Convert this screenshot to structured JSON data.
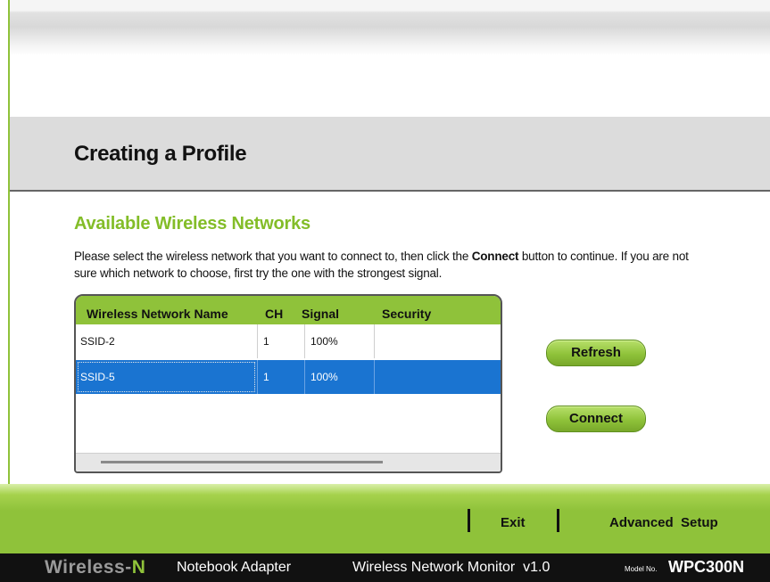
{
  "header": {
    "title": "Creating a Profile"
  },
  "section": {
    "title": "Available Wireless Networks",
    "instructions_before": "Please select the wireless network that you want to connect to, then click the ",
    "instructions_bold": "Connect",
    "instructions_after": " button to continue. If you are not sure which network to choose, first try the one with the strongest signal."
  },
  "table": {
    "columns": [
      "Wireless Network Name",
      "CH",
      "Signal",
      "Security"
    ],
    "rows": [
      {
        "name": "SSID-2",
        "ch": "1",
        "signal": "100%",
        "security": "",
        "selected": false
      },
      {
        "name": "SSID-5",
        "ch": "1",
        "signal": "100%",
        "security": "",
        "selected": true
      }
    ]
  },
  "buttons": {
    "refresh": "Refresh",
    "connect": "Connect"
  },
  "footer": {
    "exit": "Exit",
    "advanced_setup": "Advanced  Setup"
  },
  "bottom_bar": {
    "brand_prefix": "Wireless-",
    "brand_suffix": "N",
    "product": "Notebook Adapter",
    "monitor": "Wireless Network Monitor  v1.0",
    "model_label": "Model No.",
    "model_value": "WPC300N"
  },
  "colors": {
    "accent_green": "#8fc23a",
    "selection_blue": "#1a74d1",
    "dark_bar": "#111111"
  }
}
